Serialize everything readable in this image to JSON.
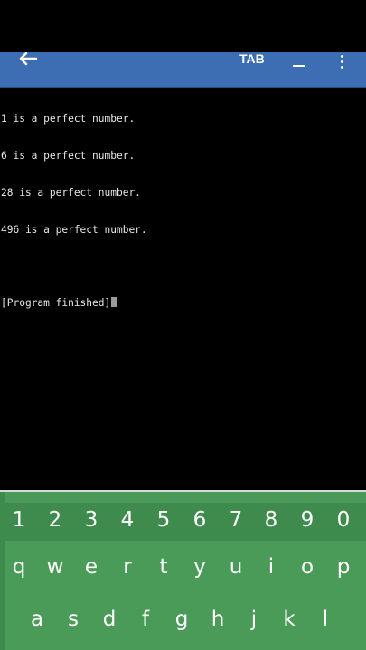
{
  "toolbar": {
    "back_icon": "arrow-left-icon",
    "tab_label": "TAB",
    "minimize_icon": "minimize-icon",
    "more_icon": "more-vertical-icon",
    "background": "#3d6eb4"
  },
  "terminal": {
    "lines": [
      "1 is a perfect number.",
      "6 is a perfect number.",
      "28 is a perfect number.",
      "496 is a perfect number.",
      "",
      "[Program finished]"
    ],
    "text_color": "#e8e8e8",
    "background": "#000000"
  },
  "keyboard": {
    "background": "#4a9a58",
    "number_row": [
      "1",
      "2",
      "3",
      "4",
      "5",
      "6",
      "7",
      "8",
      "9",
      "0"
    ],
    "top_row": [
      "q",
      "w",
      "e",
      "r",
      "t",
      "y",
      "u",
      "i",
      "o",
      "p"
    ],
    "middle_row": [
      "a",
      "s",
      "d",
      "f",
      "g",
      "h",
      "j",
      "k",
      "l"
    ]
  }
}
